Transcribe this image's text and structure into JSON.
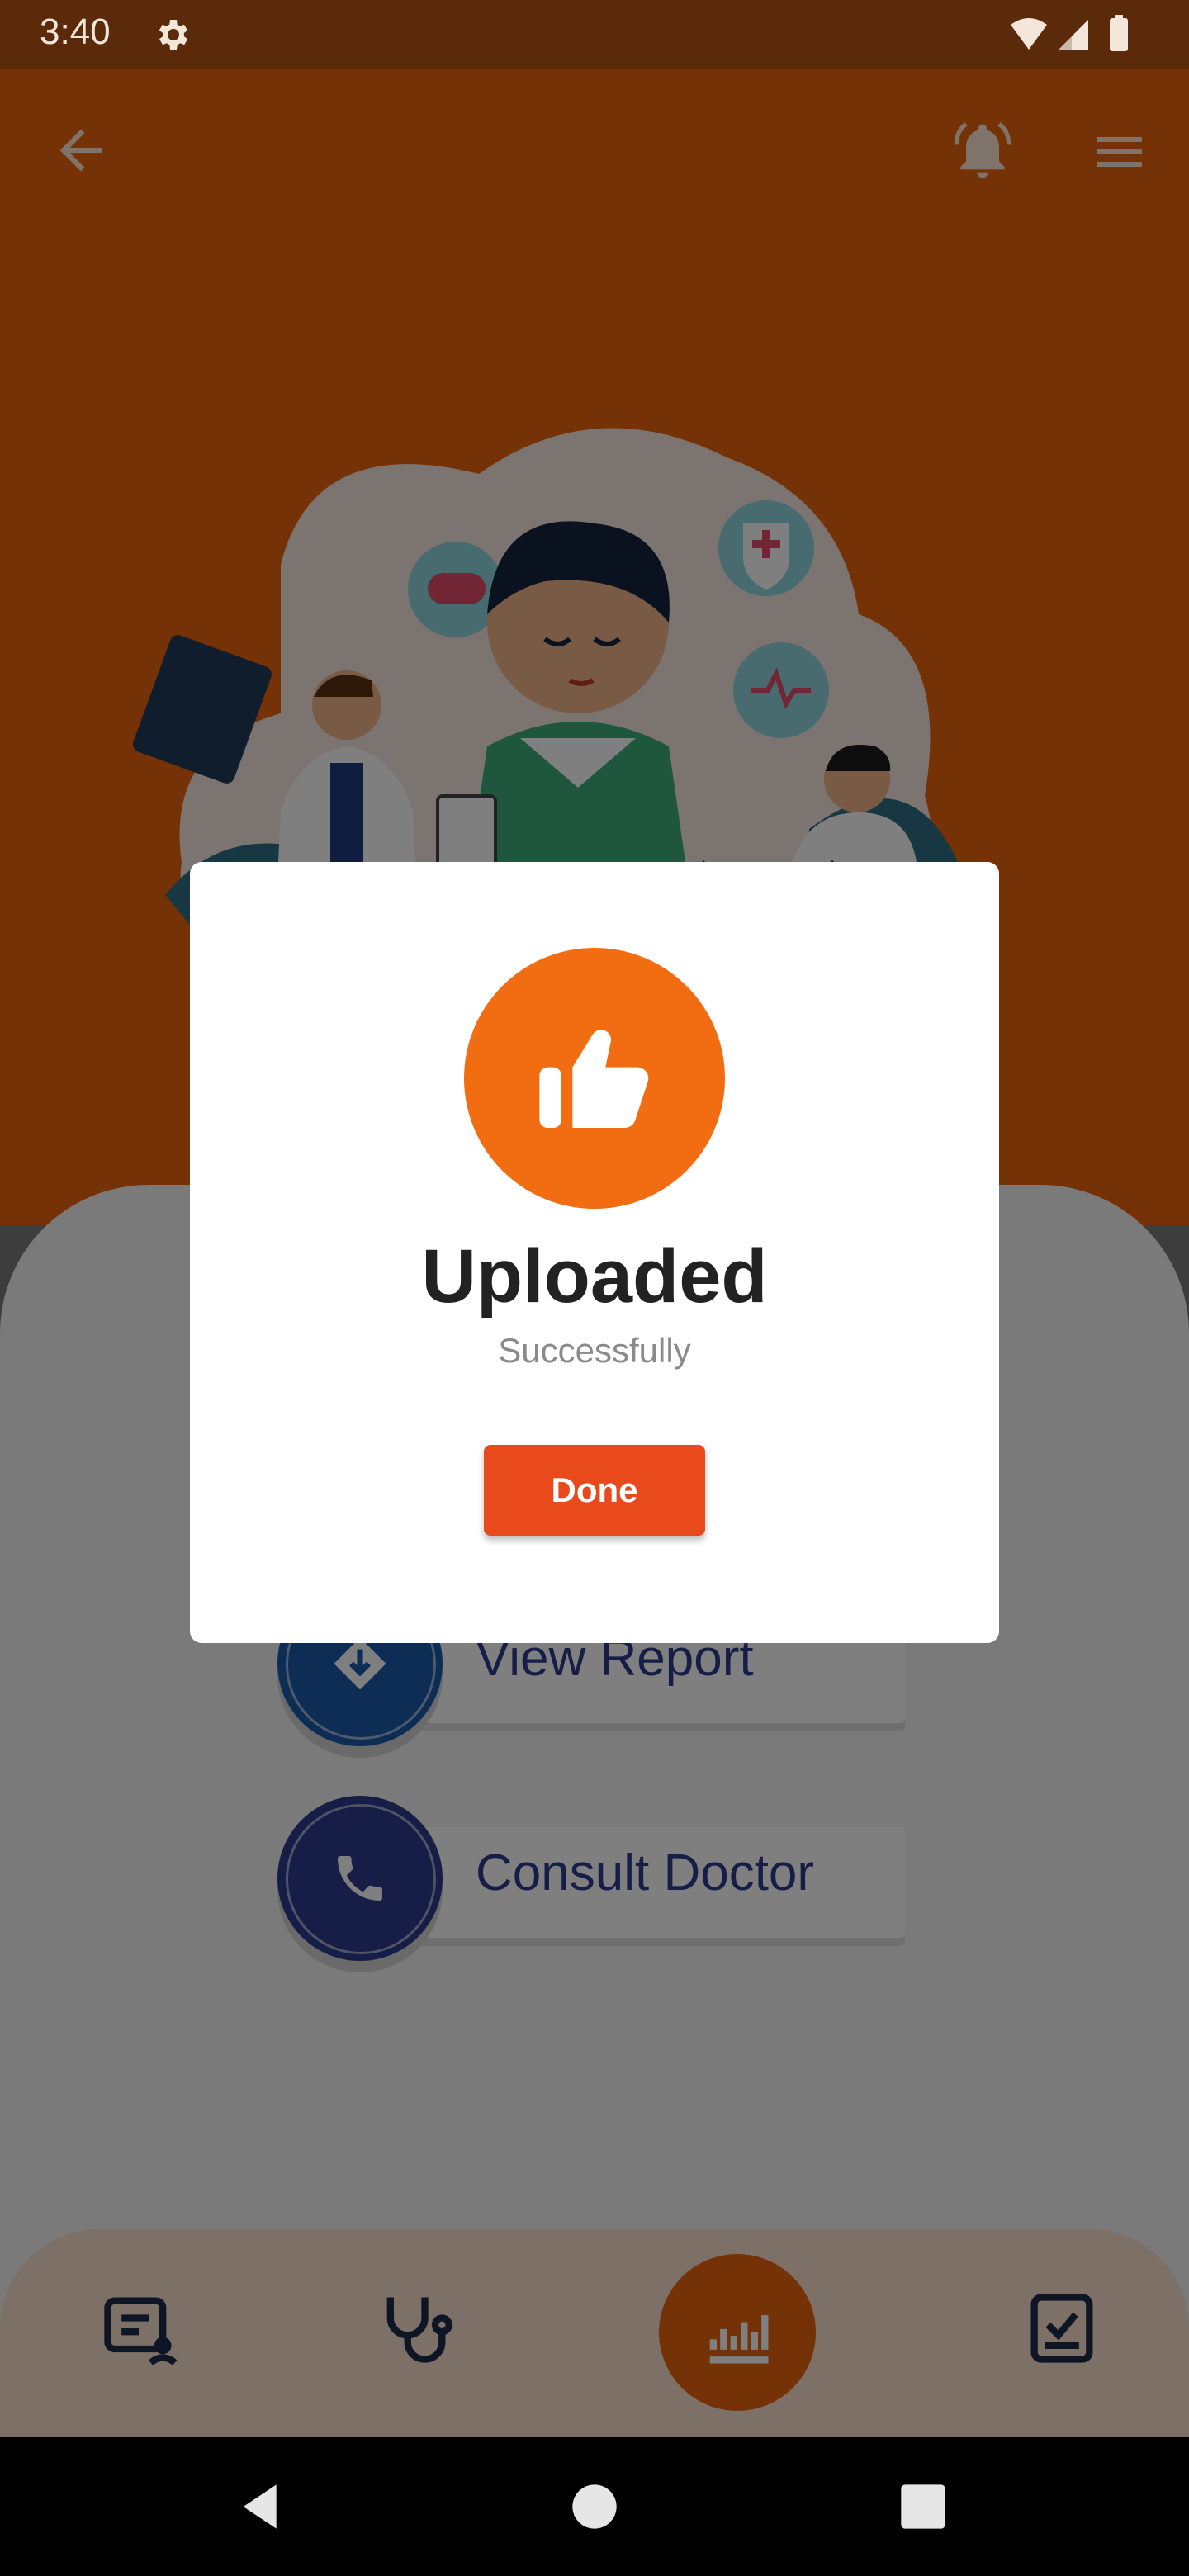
{
  "status_bar": {
    "time": "3:40"
  },
  "header": {
    "back_icon": "arrow-left-icon",
    "bell_icon": "bell-ringing-icon",
    "menu_icon": "hamburger-menu-icon"
  },
  "actions": [
    {
      "label": "View Report",
      "icon": "download-report-icon"
    },
    {
      "label": "Consult Doctor",
      "icon": "phone-icon"
    }
  ],
  "bottom_nav": {
    "items": [
      {
        "icon": "report-user-icon"
      },
      {
        "icon": "stethoscope-icon"
      },
      {
        "icon": "chart-upload-icon",
        "active": true
      },
      {
        "icon": "checklist-icon"
      }
    ]
  },
  "dialog": {
    "icon": "thumbs-up-icon",
    "title": "Uploaded",
    "subtitle": "Successfully",
    "done_label": "Done"
  },
  "colors": {
    "accent": "#e8650d",
    "button": "#e84a1c",
    "navy": "#2d3b8e"
  }
}
